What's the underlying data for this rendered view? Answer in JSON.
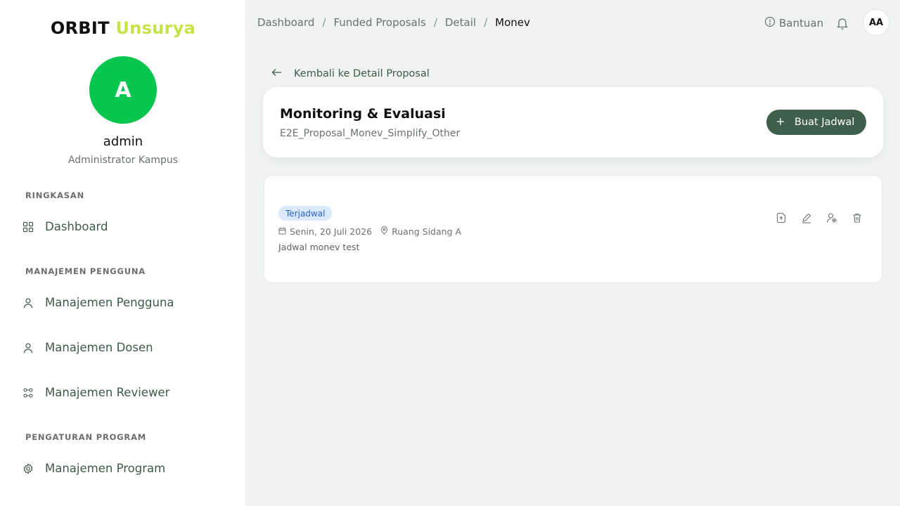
{
  "brand": {
    "part1": "ORBIT",
    "part2": "Unsurya"
  },
  "user": {
    "initial": "A",
    "name": "admin",
    "role": "Administrator Kampus"
  },
  "sidebar": {
    "sections": [
      {
        "label": "RINGKASAN",
        "items": [
          {
            "label": "Dashboard",
            "icon": "grid-icon"
          }
        ]
      },
      {
        "label": "MANAJEMEN PENGGUNA",
        "items": [
          {
            "label": "Manajemen Pengguna",
            "icon": "user-icon"
          },
          {
            "label": "Manajemen Dosen",
            "icon": "user-icon"
          },
          {
            "label": "Manajemen Reviewer",
            "icon": "network-icon"
          }
        ]
      },
      {
        "label": "PENGATURAN PROGRAM",
        "items": [
          {
            "label": "Manajemen Program",
            "icon": "gear-icon"
          }
        ]
      }
    ]
  },
  "breadcrumb": [
    "Dashboard",
    "Funded Proposals",
    "Detail",
    "Monev"
  ],
  "topbar": {
    "help_label": "Bantuan",
    "avatar_initials": "AA"
  },
  "back_link": "Kembali ke Detail Proposal",
  "header": {
    "title": "Monitoring & Evaluasi",
    "subtitle": "E2E_Proposal_Monev_Simplify_Other",
    "create_button": "Buat Jadwal"
  },
  "schedule": {
    "status": "Terjadwal",
    "date": "Senin, 20 Juli 2026",
    "location": "Ruang Sidang A",
    "description": "Jadwal monev test"
  },
  "colors": {
    "accent": "#3f5f4b",
    "avatar": "#06c64f",
    "brand_highlight": "#c6e34a",
    "badge_bg": "#dbe9ff",
    "badge_text": "#2a63c9"
  }
}
